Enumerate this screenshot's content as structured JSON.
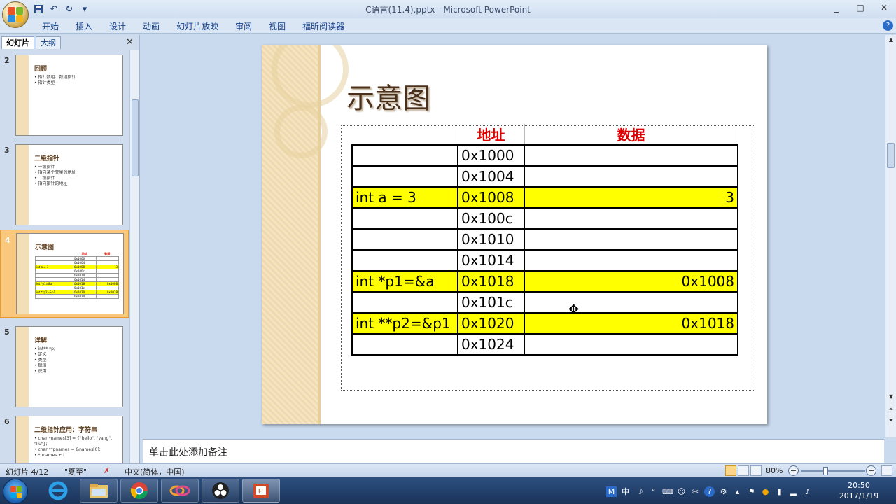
{
  "window": {
    "title": "C语言(11.4).pptx - Microsoft PowerPoint",
    "minimize": "_",
    "maximize": "□",
    "close": "✕"
  },
  "quick_access": [
    "save-icon",
    "undo-icon",
    "redo-icon",
    "customize-icon"
  ],
  "ribbon": {
    "tabs": [
      "开始",
      "插入",
      "设计",
      "动画",
      "幻灯片放映",
      "审阅",
      "视图",
      "福昕阅读器"
    ],
    "help": "?"
  },
  "panel": {
    "tabs": [
      "幻灯片",
      "大纲"
    ],
    "close": "✕"
  },
  "thumbnails": [
    {
      "num": "2",
      "title": "回顾",
      "lines": [
        "• 指针数组、数组指针",
        "• 指针类型"
      ]
    },
    {
      "num": "3",
      "title": "二级指针",
      "lines": [
        "• 一级指针",
        "  • 指向某个变量的地址",
        "",
        "• 二级指针",
        "  • 指向指针的地址"
      ]
    },
    {
      "num": "4",
      "title": "示意图",
      "lines": []
    },
    {
      "num": "5",
      "title": "详解",
      "lines": [
        "• int** *p;",
        "",
        "• 定义",
        "• 类型",
        "• 赋值",
        "• 使用"
      ]
    },
    {
      "num": "6",
      "title": "二级指针应用：字符串",
      "lines": [
        "• char *names[3] = {\"hello\", \"yang\",",
        "  \"liu\"};",
        "• char **pnames = &names[0];",
        "",
        "• *pnames + i"
      ]
    }
  ],
  "slide": {
    "title": "示意图",
    "table": {
      "headers": [
        "",
        "地址",
        "数据"
      ],
      "rows": [
        {
          "var": "",
          "addr": "0x1000",
          "data": "",
          "highlight": false
        },
        {
          "var": "",
          "addr": "0x1004",
          "data": "",
          "highlight": false
        },
        {
          "var": "int a = 3",
          "addr": "0x1008",
          "data": "3",
          "highlight": true
        },
        {
          "var": "",
          "addr": "0x100c",
          "data": "",
          "highlight": false
        },
        {
          "var": "",
          "addr": "0x1010",
          "data": "",
          "highlight": false
        },
        {
          "var": "",
          "addr": "0x1014",
          "data": "",
          "highlight": false
        },
        {
          "var": "int *p1=&a",
          "addr": "0x1018",
          "data": "0x1008",
          "highlight": true
        },
        {
          "var": "",
          "addr": "0x101c",
          "data": "",
          "highlight": false
        },
        {
          "var": "int **p2=&p1",
          "addr": "0x1020",
          "data": "0x1018",
          "highlight": true
        },
        {
          "var": "",
          "addr": "0x1024",
          "data": "",
          "highlight": false
        }
      ]
    },
    "highlight_color": "#ffff00",
    "header_color": "#e00000"
  },
  "notes": {
    "placeholder": "单击此处添加备注"
  },
  "status": {
    "slide_count": "幻灯片 4/12",
    "theme": "\"夏至\"",
    "language": "中文(简体，中国)",
    "zoom": "80%",
    "zoom_out": "−",
    "zoom_in": "+"
  },
  "taskbar": {
    "apps": [
      "ie-icon",
      "explorer-icon",
      "chrome-icon",
      "app-icon",
      "obs-icon",
      "powerpoint-icon"
    ],
    "time": "20:50",
    "date": "2017/1/19",
    "tray_icons": [
      "M",
      "中",
      "☽",
      "°",
      "⌨",
      "☺",
      "✂",
      "?",
      "⚙"
    ]
  }
}
